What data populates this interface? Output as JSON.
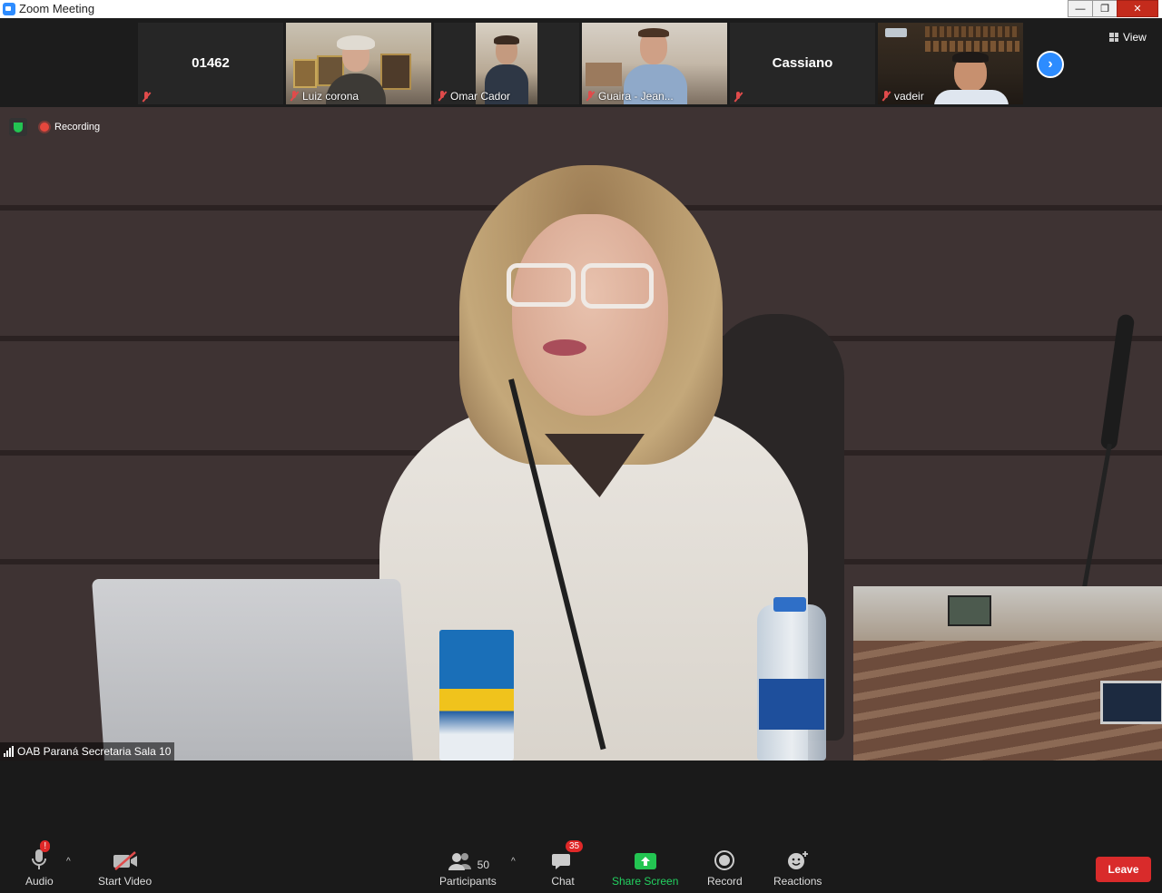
{
  "window": {
    "title": "Zoom Meeting",
    "minimize": "—",
    "maximize": "❐",
    "close": "✕"
  },
  "strip": {
    "tiles": [
      {
        "name": "01462",
        "type": "name"
      },
      {
        "name": "Luiz corona",
        "type": "video"
      },
      {
        "name": "Omar Cador",
        "type": "video"
      },
      {
        "name": "Guaira - Jean...",
        "type": "video"
      },
      {
        "name": "Cassiano",
        "type": "name"
      },
      {
        "name": "vadeir",
        "type": "video"
      }
    ],
    "next_icon": "›",
    "view_label": "View"
  },
  "status": {
    "recording_label": "Recording"
  },
  "main": {
    "speaker_label": "OAB Paraná Secretaria Sala 10"
  },
  "toolbar": {
    "audio_label": "Audio",
    "audio_alert": "!",
    "start_video_label": "Start Video",
    "participants_label": "Participants",
    "participants_count": "50",
    "chat_label": "Chat",
    "chat_badge": "35",
    "share_screen_label": "Share Screen",
    "record_label": "Record",
    "reactions_label": "Reactions",
    "leave_label": "Leave",
    "caret": "^"
  },
  "colors": {
    "accent": "#2d8cff",
    "share": "#23d160",
    "leave": "#d92b2b",
    "recording": "#e5473d"
  }
}
